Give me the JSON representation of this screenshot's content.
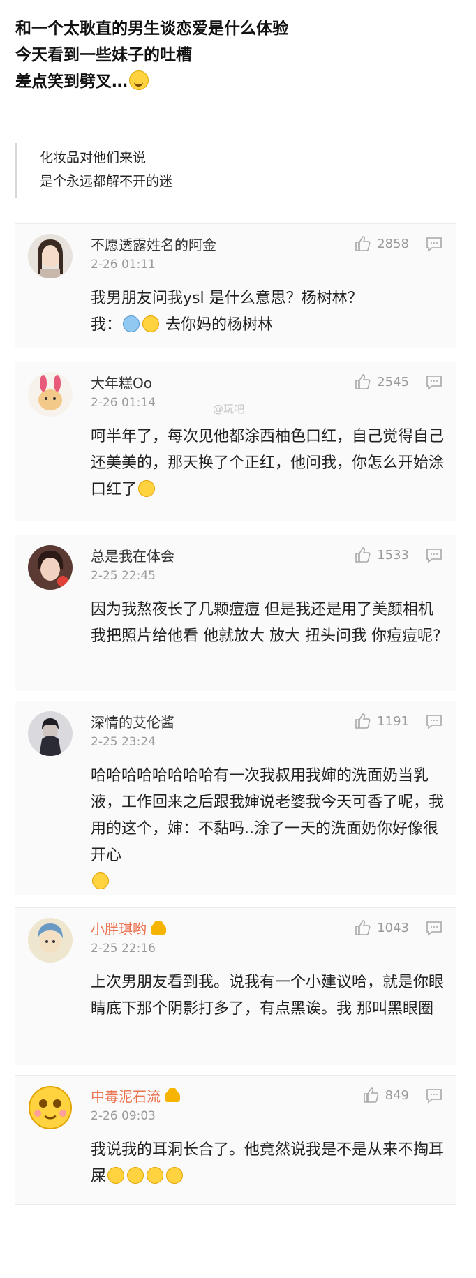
{
  "intro": {
    "line1": "和一个太耿直的男生谈恋爱是什么体验",
    "line2": "今天看到一些妹子的吐槽",
    "line3": "差点笑到劈叉…",
    "line3_emoji": "laughing-tears-emoji"
  },
  "quote": {
    "line1": "化妆品对他们来说",
    "line2": "是个永远都解不开的迷"
  },
  "watermark": "@玩吧",
  "comments": [
    {
      "username": "不愿透露姓名的阿金",
      "time": "2-26 01:11",
      "likes": "2858",
      "text_line1": "我男朋友问我ysl 是什么意思？杨树林？",
      "text_line2_prefix": "我：",
      "text_line2_suffix": "去你妈的杨树林",
      "vip": false
    },
    {
      "username": "大年糕Oo",
      "time": "2-26 01:14",
      "likes": "2545",
      "text": "呵半年了，每次见他都涂西柚色口红，自己觉得自己还美美的，那天换了个正红，他问我，你怎么开始涂口红了",
      "vip": false
    },
    {
      "username": "总是我在体会",
      "time": "2-25 22:45",
      "likes": "1533",
      "text": "因为我熬夜长了几颗痘痘 但是我还是用了美颜相机 我把照片给他看 他就放大 放大 扭头问我 你痘痘呢?",
      "vip": false
    },
    {
      "username": "深情的艾伦酱",
      "time": "2-25 23:24",
      "likes": "1191",
      "text": "哈哈哈哈哈哈哈哈有一次我叔用我婶的洗面奶当乳液，工作回来之后跟我婶说老婆我今天可香了呢，我用的这个，婶：不黏吗..涂了一天的洗面奶你好像很开心",
      "vip": false
    },
    {
      "username": "小胖琪哟",
      "time": "2-25 22:16",
      "likes": "1043",
      "text": "上次男朋友看到我。说我有一个小建议哈，就是你眼睛底下那个阴影打多了，有点黑诶。我 那叫黑眼圈",
      "vip": true
    },
    {
      "username": "中毒泥石流",
      "time": "2-26 09:03",
      "likes": "849",
      "text": "我说我的耳洞长合了。他竟然说我是不是从来不掏耳屎",
      "vip": true
    }
  ],
  "colors": {
    "background": "#ffffff",
    "card": "#fafafa",
    "vip_name": "#eb7350",
    "meta": "#9a9a9a"
  }
}
